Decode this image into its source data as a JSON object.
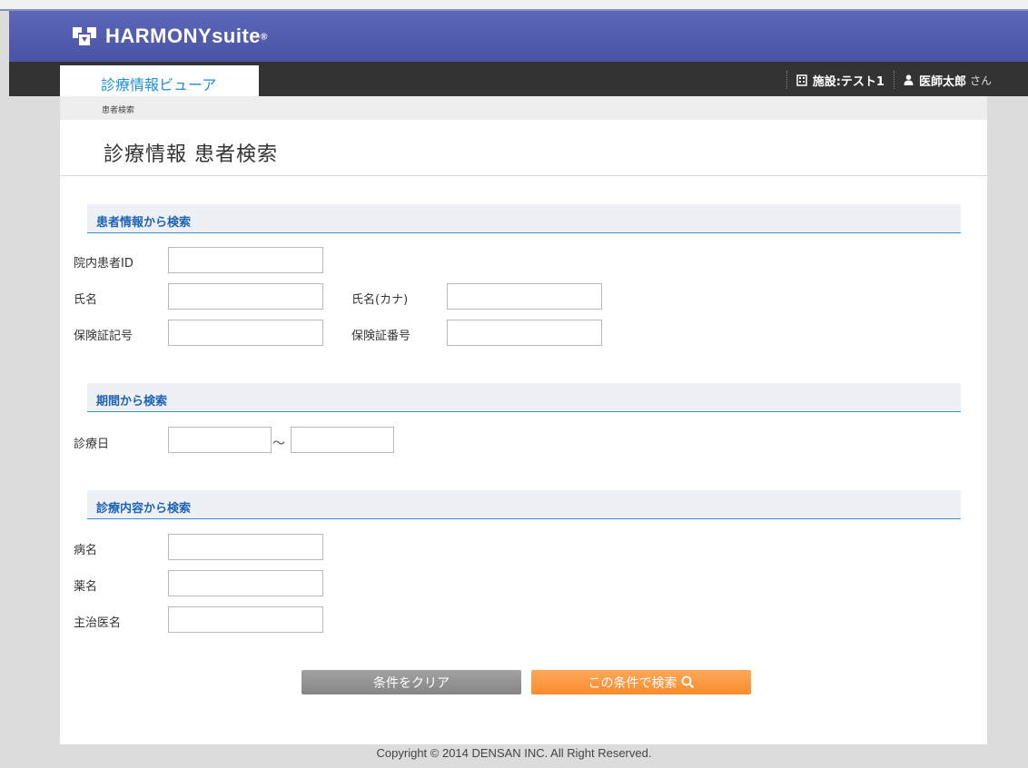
{
  "brand": {
    "name": "HARMONYsuite",
    "mark": "®"
  },
  "nav": {
    "active_tab": "診療情報ビューア",
    "facility_label": "施設:テスト1",
    "user_name": "医師太郎",
    "user_suffix": "さん",
    "facility_icon": "building-icon",
    "user_icon": "user-icon"
  },
  "breadcrumb": "患者検索",
  "page_title": "診療情報 患者検索",
  "sections": {
    "patient": {
      "title": "患者情報から検索",
      "labels": {
        "patient_id": "院内患者ID",
        "name": "氏名",
        "name_kana": "氏名(カナ)",
        "insurance_symbol": "保険証記号",
        "insurance_number": "保険証番号"
      },
      "values": {
        "patient_id": "",
        "name": "",
        "name_kana": "",
        "insurance_symbol": "",
        "insurance_number": ""
      }
    },
    "period": {
      "title": "期間から検索",
      "labels": {
        "visit_date": "診療日",
        "range_sep": "～"
      },
      "values": {
        "from": "",
        "to": ""
      }
    },
    "content": {
      "title": "診療内容から検索",
      "labels": {
        "disease": "病名",
        "drug": "薬名",
        "doctor": "主治医名"
      },
      "values": {
        "disease": "",
        "drug": "",
        "doctor": ""
      }
    }
  },
  "buttons": {
    "clear": "条件をクリア",
    "search": "この条件で検索",
    "search_icon": "search-icon"
  },
  "footer": "Copyright © 2014 DENSAN INC. All Right Reserved.",
  "colors": {
    "header": "#4f59a8",
    "navbar": "#333333",
    "accent": "#1f8fd6",
    "section_text": "#1f63b5",
    "search_button": "#f98b2c",
    "clear_button": "#8e8e8e"
  }
}
